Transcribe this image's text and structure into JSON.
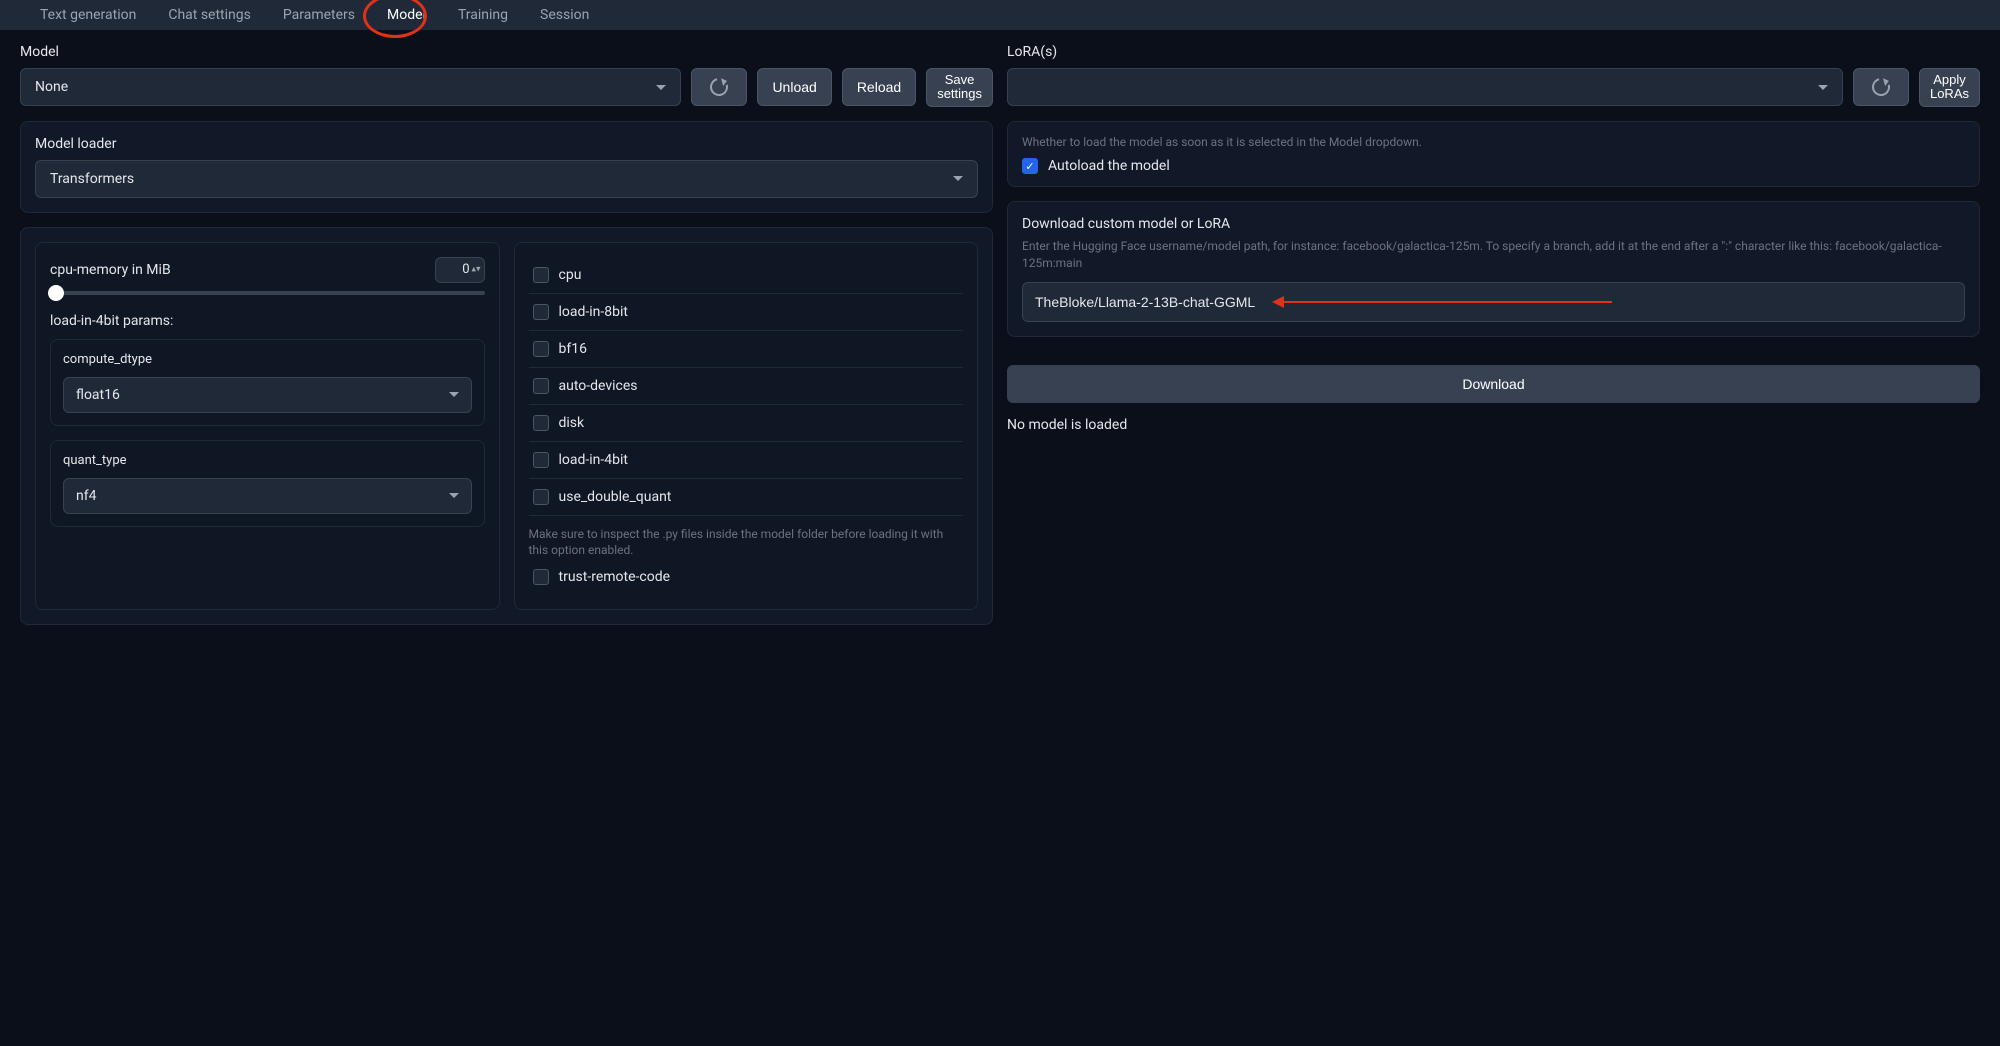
{
  "tabs": [
    "Text generation",
    "Chat settings",
    "Parameters",
    "Model",
    "Training",
    "Session"
  ],
  "active_tab_index": 3,
  "left": {
    "model_label": "Model",
    "model_value": "None",
    "unload": "Unload",
    "reload": "Reload",
    "save_settings_l1": "Save",
    "save_settings_l2": "settings",
    "loader_label": "Model loader",
    "loader_value": "Transformers",
    "slider_label": "cpu-memory in MiB",
    "slider_value": "0",
    "load4bit_label": "load-in-4bit params:",
    "compute_dtype_label": "compute_dtype",
    "compute_dtype_value": "float16",
    "quant_type_label": "quant_type",
    "quant_type_value": "nf4",
    "checks": [
      "cpu",
      "load-in-8bit",
      "bf16",
      "auto-devices",
      "disk",
      "load-in-4bit",
      "use_double_quant"
    ],
    "trust_hint": "Make sure to inspect the .py files inside the model folder before loading it with this option enabled.",
    "trust_label": "trust-remote-code"
  },
  "right": {
    "loras_label": "LoRA(s)",
    "apply_loras_l1": "Apply",
    "apply_loras_l2": "LoRAs",
    "autoload_hint": "Whether to load the model as soon as it is selected in the Model dropdown.",
    "autoload_label": "Autoload the model",
    "download_heading": "Download custom model or LoRA",
    "download_hint": "Enter the Hugging Face username/model path, for instance: facebook/galactica-125m. To specify a branch, add it at the end after a \":\" character like this: facebook/galactica-125m:main",
    "download_value": "TheBloke/Llama-2-13B-chat-GGML",
    "download_button": "Download",
    "status": "No model is loaded"
  }
}
